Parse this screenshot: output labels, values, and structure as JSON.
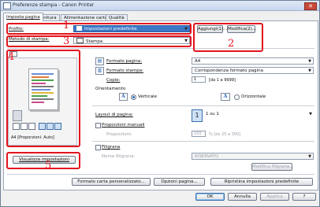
{
  "window": {
    "title": "Preferenze stampa - Canon Printer"
  },
  "tabs": [
    {
      "label": "Imposta pagina"
    },
    {
      "label": "Finitura"
    },
    {
      "label": "Alimentazione carta"
    },
    {
      "label": "Qualità"
    }
  ],
  "profile": {
    "label": "Profilo:",
    "value": "Impostazioni predefinite",
    "add_label": "Aggiungi(1)...",
    "edit_label": "Modifica(2)..."
  },
  "output_method": {
    "label": "Metodo di stampa:",
    "value": "Stampa"
  },
  "preview": {
    "caption": "A4 [Proporzioni: Auto]"
  },
  "view_settings_label": "Visualizza impostazioni",
  "page_size": {
    "label": "Formato pagina:",
    "value": "A4"
  },
  "output_size": {
    "label": "Formato stampa:",
    "value": "Corrispondenza formato pagina"
  },
  "copies": {
    "label": "Copie:",
    "value": "1",
    "range": "[da 1 a 9999]"
  },
  "orientation": {
    "label": "Orientamento",
    "portrait": "Verticale",
    "landscape": "Orizzontale",
    "selected": "portrait"
  },
  "page_layout": {
    "label": "Layout di pagina:",
    "value": "1 su 1"
  },
  "manual_scaling": {
    "label": "Proporzioni manuali",
    "scale_label": "Proporzioni:",
    "value": "100",
    "range": "% [da 25 a 300]"
  },
  "watermark": {
    "label": "Filigrana",
    "name_label": "Nome filigrana:",
    "name_value": "RISERVATO",
    "edit_label": "Modifica filigrana..."
  },
  "footer_buttons": {
    "custom_paper": "Formato carta personalizzato...",
    "page_options": "Opzioni pagina...",
    "restore": "Ripristina impostazioni predefinite"
  },
  "dialog_buttons": {
    "ok": "OK",
    "cancel": "Annulla",
    "apply": "Applica",
    "help": "?"
  },
  "callouts": [
    "1",
    "2",
    "3",
    "4",
    "5"
  ],
  "colors": {
    "callout": "#e3141e",
    "selected_blue": "#3a78c7"
  }
}
